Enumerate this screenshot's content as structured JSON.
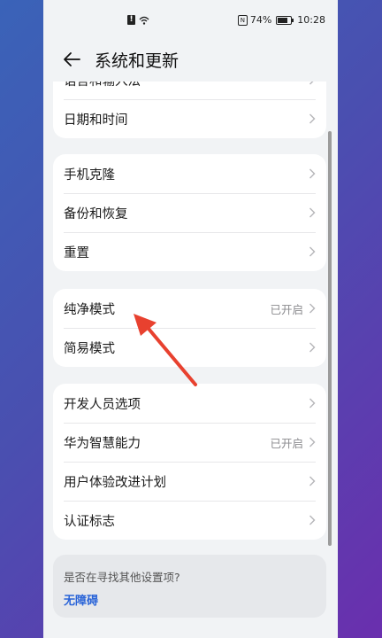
{
  "statusbar": {
    "center_mark": "!",
    "battery": "74%",
    "time": "10:28",
    "battery_level": 0.74
  },
  "header": {
    "title": "系统和更新"
  },
  "groups": [
    {
      "items": [
        {
          "label": "语言和输入法"
        },
        {
          "label": "日期和时间"
        }
      ]
    },
    {
      "items": [
        {
          "label": "手机克隆"
        },
        {
          "label": "备份和恢复"
        },
        {
          "label": "重置"
        }
      ]
    },
    {
      "items": [
        {
          "label": "纯净模式",
          "value": "已开启"
        },
        {
          "label": "简易模式"
        }
      ]
    },
    {
      "items": [
        {
          "label": "开发人员选项"
        },
        {
          "label": "华为智慧能力",
          "value": "已开启"
        },
        {
          "label": "用户体验改进计划"
        },
        {
          "label": "认证标志"
        }
      ]
    }
  ],
  "search": {
    "question": "是否在寻找其他设置项?",
    "link": "无障碍"
  },
  "colors": {
    "accent": "#2a64d8",
    "annotation_arrow": "#e8412f"
  }
}
